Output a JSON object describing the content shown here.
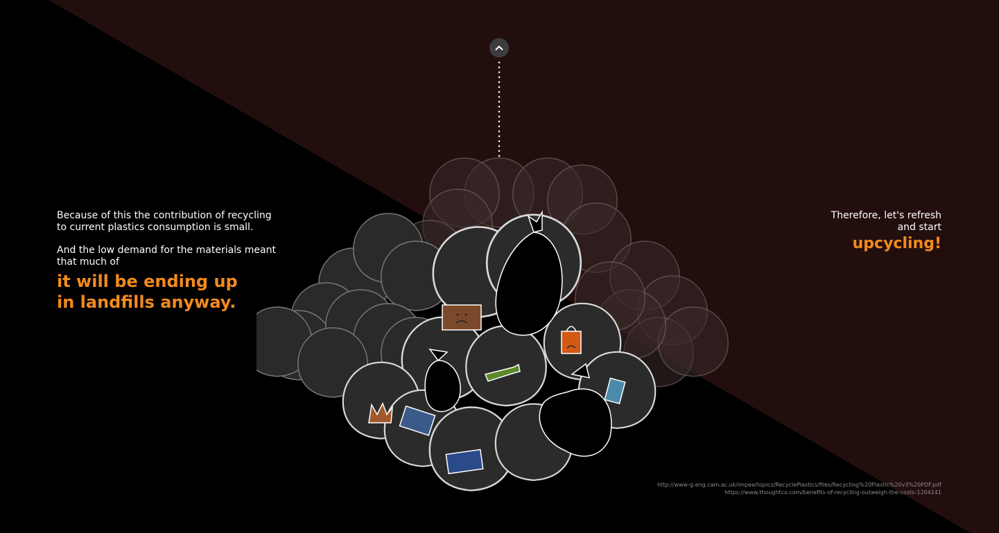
{
  "left_text": {
    "paragraph_1": "Because of this the contribution of recycling to current plastics consumption is small.",
    "paragraph_2": "And the low demand for the materials meant that much of",
    "highlight_line_1": "it will be ending up",
    "highlight_line_2": "in landfills anyway."
  },
  "right_text": {
    "line_1": "Therefore, let's refresh",
    "line_2": "and start",
    "highlight": "upcycling!"
  },
  "sources": [
    "http://www-g.eng.cam.ac.uk/impee/topics/RecyclePlastics/files/Recycling%20Plastic%20v3%20PDF.pdf",
    "https://www.thoughtco.com/benefits-of-recycling-outweigh-the-costs-1204141"
  ],
  "icons": {
    "scroll_up": "chevron-up-icon",
    "bags": "garbage-bag-icon",
    "sad_box": "sad-box-icon",
    "sad_shopping_bag": "sad-shopping-bag-icon",
    "sad_bottle": "sad-bottle-icon",
    "sad_can": "sad-can-icon",
    "sad_crown": "sad-crown-icon",
    "sad_card": "sad-card-icon"
  },
  "colors": {
    "background": "#000000",
    "backdrop_maroon": "#230e0e",
    "accent_orange": "#f28a1e",
    "bag_fill": "#2b2b2b",
    "bag_outline": "#d9d9d9"
  }
}
